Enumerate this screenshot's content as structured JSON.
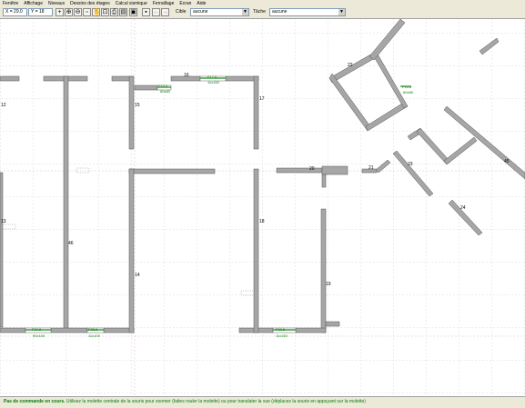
{
  "menu": [
    "Fenêtre",
    "Affichage",
    "Niveaux",
    "Dessins des étages",
    "Calcul sismique",
    "Ferraillage",
    "Ecran",
    "Aide"
  ],
  "toolbar": {
    "coord_x": "X = 29.0",
    "coord_y": "Y = 18",
    "cible_label": "Cible",
    "cible_value": "aucune",
    "tache_label": "Tâche",
    "tache_value": "aucune"
  },
  "plan": {
    "wall_labels": [
      "12",
      "13",
      "46",
      "15",
      "14",
      "16",
      "17",
      "18",
      "20",
      "21",
      "19",
      "22",
      "23",
      "24",
      "45"
    ],
    "openings": [
      {
        "name": "F10.6",
        "size": "60x60"
      },
      {
        "name": "F17.6",
        "size": "11x150"
      },
      {
        "name": "F15.6",
        "size": "60x65"
      },
      {
        "name": "F24.6",
        "size": "90x100"
      },
      {
        "name": "F23.6",
        "size": "11x100"
      },
      {
        "name": "F19.6",
        "size": "11x150"
      }
    ]
  },
  "status": {
    "bold": "Pas de commande en cours.",
    "text": "Utilisez la molette centrale de la souris pour zoomer (faites rouler la molette) ou pour translater la vue (déplacez la souris en appuyant sur la molette)"
  }
}
